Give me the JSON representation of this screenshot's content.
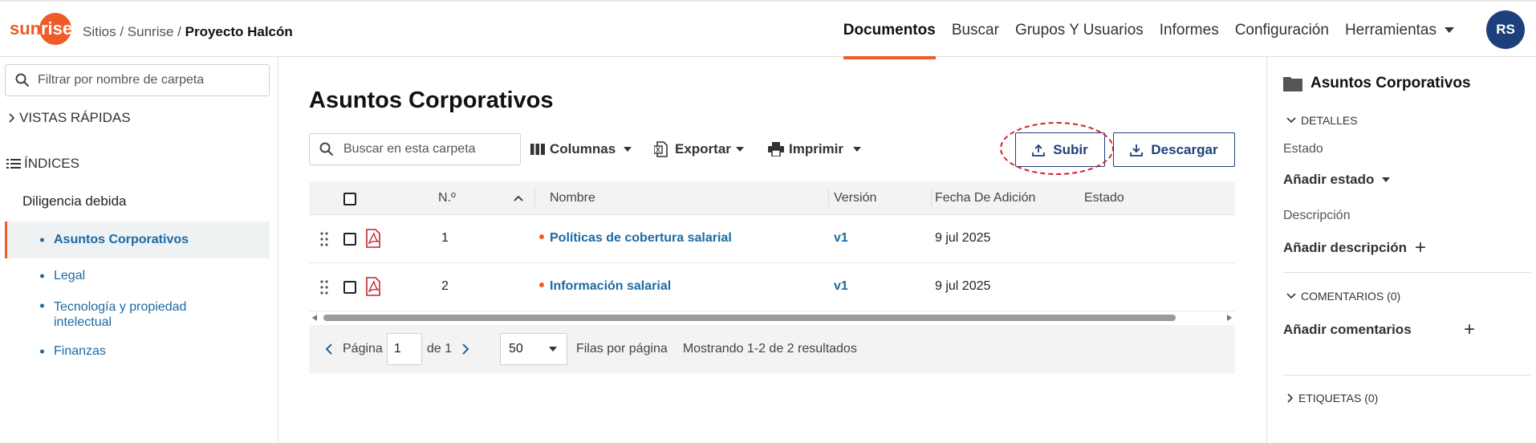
{
  "brand": {
    "logo_text": "sunrise",
    "accent": "#ee5a2a",
    "navy": "#1d3f7b"
  },
  "breadcrumb": {
    "sites": "Sitios",
    "sep1": "/",
    "site": "Sunrise",
    "sep2": "/",
    "project": "Proyecto Halcón"
  },
  "nav": {
    "items": [
      {
        "label": "Documentos",
        "active": true
      },
      {
        "label": "Buscar"
      },
      {
        "label": "Grupos Y Usuarios"
      },
      {
        "label": "Informes"
      },
      {
        "label": "Configuración"
      },
      {
        "label": "Herramientas",
        "dropdown": true
      }
    ],
    "avatar_initials": "RS"
  },
  "sidebar": {
    "filter_placeholder": "Filtrar por nombre de carpeta",
    "quick_views": "VISTAS RÁPIDAS",
    "indices": "ÍNDICES",
    "section": "Diligencia debida",
    "items": [
      {
        "label": "Asuntos Corporativos",
        "selected": true
      },
      {
        "label": "Legal"
      },
      {
        "label": "Tecnología y propiedad intelectual"
      },
      {
        "label": "Finanzas"
      }
    ]
  },
  "main": {
    "title": "Asuntos Corporativos",
    "search_placeholder": "Buscar en esta carpeta",
    "toolbar": {
      "columns": "Columnas",
      "export": "Exportar",
      "print": "Imprimir",
      "upload": "Subir",
      "download": "Descargar"
    },
    "table": {
      "headers": {
        "num": "N.º",
        "name": "Nombre",
        "version": "Versión",
        "date": "Fecha De Adición",
        "status": "Estado"
      },
      "rows": [
        {
          "num": "1",
          "name": "Políticas de cobertura salarial",
          "version": "v1",
          "date": "9 jul 2025",
          "status": ""
        },
        {
          "num": "2",
          "name": "Información salarial",
          "version": "v1",
          "date": "9 jul 2025",
          "status": ""
        }
      ]
    },
    "pager": {
      "page_label": "Página",
      "page": "1",
      "of_label": "de 1",
      "per_page": "50",
      "per_page_label": "Filas por página",
      "results": "Mostrando 1-2 de 2 resultados"
    }
  },
  "details": {
    "title": "Asuntos Corporativos",
    "details_section": "DETALLES",
    "status_label": "Estado",
    "add_status": "Añadir estado",
    "description_label": "Descripción",
    "add_description": "Añadir descripción",
    "comments_section": "COMENTARIOS (0)",
    "add_comments": "Añadir comentarios",
    "tags_section": "ETIQUETAS (0)"
  }
}
